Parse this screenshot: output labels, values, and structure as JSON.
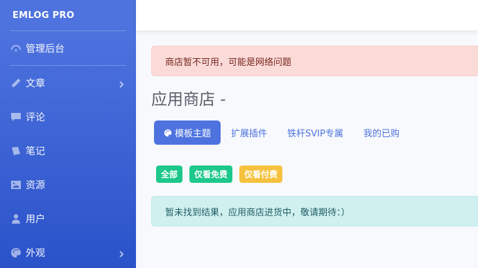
{
  "sidebar": {
    "brand": "EMLOG PRO",
    "items": [
      {
        "label": "管理后台",
        "icon": "speedometer-icon",
        "has_children": false
      },
      {
        "label": "文章",
        "icon": "pencil-icon",
        "has_children": true
      },
      {
        "label": "评论",
        "icon": "comment-icon",
        "has_children": false
      },
      {
        "label": "笔记",
        "icon": "sticky-note-icon",
        "has_children": false
      },
      {
        "label": "资源",
        "icon": "image-icon",
        "has_children": false
      },
      {
        "label": "用户",
        "icon": "user-icon",
        "has_children": false
      },
      {
        "label": "外观",
        "icon": "palette-icon",
        "has_children": true
      }
    ]
  },
  "alert_error": "商店暂不可用，可能是网络问题",
  "page": {
    "title": "应用商店 -"
  },
  "tabs": [
    {
      "label": "模板主题",
      "active": true,
      "icon": "palette-icon"
    },
    {
      "label": "扩展插件",
      "active": false
    },
    {
      "label": "铁杆SVIP专属",
      "active": false
    },
    {
      "label": "我的已购",
      "active": false
    }
  ],
  "filters": {
    "all": "全部",
    "free": "仅看免费",
    "paid": "仅看付费"
  },
  "alert_info": "暂未找到结果，应用商店进货中，敬请期待：）",
  "colors": {
    "primary": "#4e73df",
    "success": "#1cc88a",
    "warning": "#f6c23e",
    "danger_bg": "#fadbd8",
    "info_bg": "#d0f0f0"
  }
}
